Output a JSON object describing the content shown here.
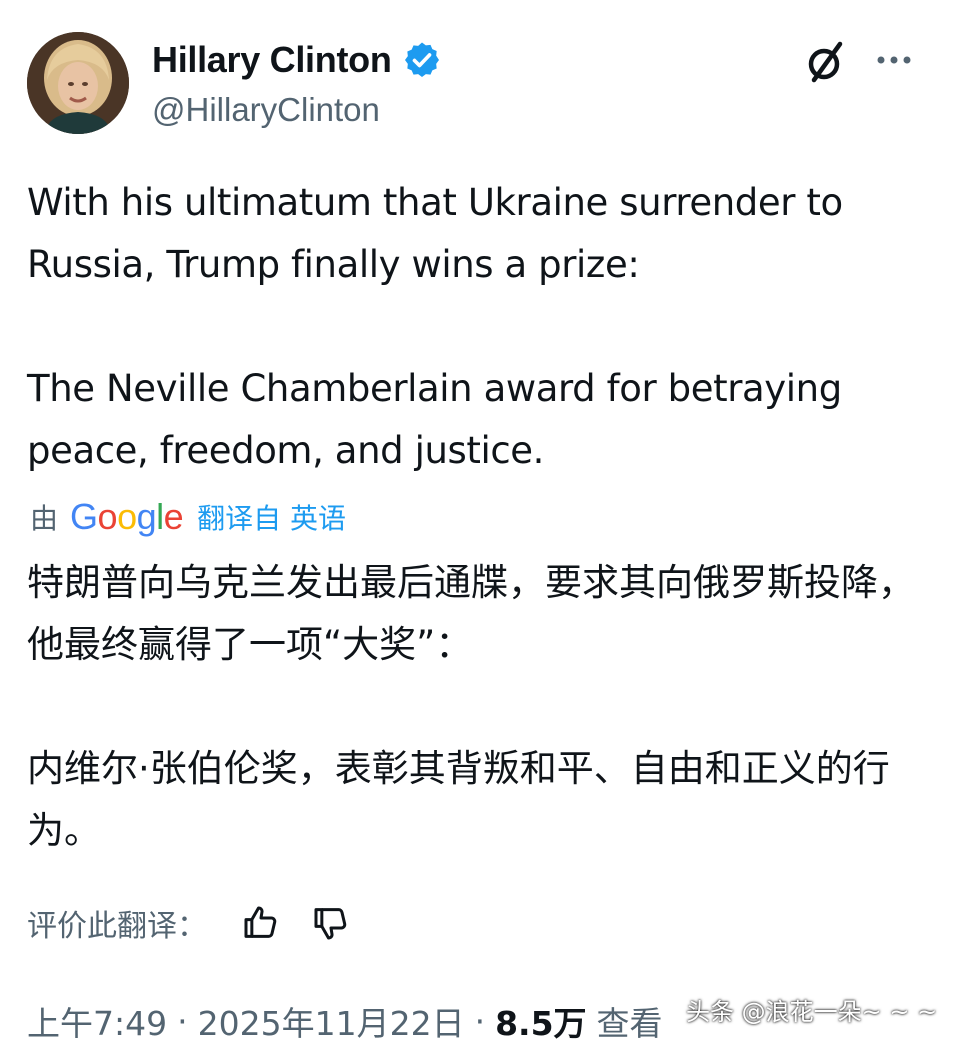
{
  "author": {
    "display_name": "Hillary Clinton",
    "handle": "@HillaryClinton",
    "verified_color": "#1d9bf0"
  },
  "tweet": {
    "paragraph_1": "With his ultimatum that Ukraine surrender to Russia, Trump finally wins a prize:",
    "paragraph_2": "The Neville Chamberlain award for betraying peace, freedom, and justice."
  },
  "translation": {
    "by_label": "由",
    "provider": "Google",
    "source_label": "翻译自 英语",
    "paragraph_1": "特朗普向乌克兰发出最后通牒，要求其向俄罗斯投降，他最终赢得了一项“大奖”：",
    "paragraph_2": "内维尔·张伯伦奖，表彰其背叛和平、自由和正义的行为。",
    "rate_label": "评价此翻译："
  },
  "meta": {
    "time": "上午7:49",
    "separator": "·",
    "date": "2025年11月22日",
    "views_count": "8.5万",
    "views_label": "查看"
  },
  "watermark": "头条 @浪花一朵~ ~ ~",
  "icons": {
    "grok": "slashed-circle-icon",
    "more": "more-dots-icon",
    "verified": "verified-badge-icon",
    "thumbs_up": "thumbs-up-icon",
    "thumbs_down": "thumbs-down-icon"
  }
}
